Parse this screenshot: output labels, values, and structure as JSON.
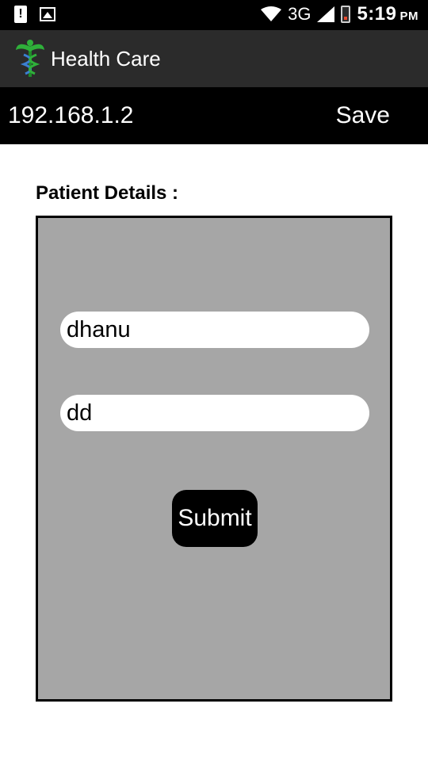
{
  "status_bar": {
    "network": "3G",
    "time": "5:19",
    "ampm": "PM"
  },
  "app_bar": {
    "title": "Health Care",
    "logo_icon": "caduceus-icon"
  },
  "ip_bar": {
    "ip_value": "192.168.1.2",
    "save_label": "Save"
  },
  "form": {
    "section_title": "Patient Details :",
    "name_value": "dhanu",
    "second_value": "dd",
    "submit_label": "Submit"
  },
  "colors": {
    "status_bg": "#000000",
    "app_bar_bg": "#2b2b2b",
    "ip_bar_bg": "#000000",
    "card_bg": "#a6a6a6",
    "button_bg": "#000000"
  }
}
